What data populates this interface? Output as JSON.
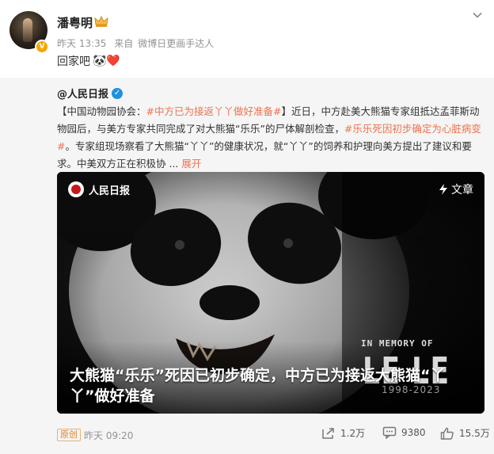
{
  "post": {
    "username": "潘粤明",
    "time": "昨天 13:35",
    "source_prefix": "来自",
    "source": "微博日更画手达人",
    "content": "回家吧",
    "content_emoji": "🐼❤️"
  },
  "repost": {
    "user": "@人民日报",
    "text_prefix": "【中国动物园协会：",
    "hashtag1": "#中方已为接返丫丫做好准备#",
    "text_mid1": "】近日，中方赴美大熊猫专家组抵达孟菲斯动物园后，与美方专家共同完成了对大熊猫“乐乐”的尸体解剖检查，",
    "hashtag2": "#乐乐死因初步确定为心脏病变#",
    "text_mid2": "。专家组现场察看了大熊猫“丫丫”的健康状况，就“丫丫”的饲养和护理向美方提出了建议和要求。中美双方正在积极协",
    "ellipsis": " ... ",
    "expand": "展开",
    "video": {
      "channel": "人民日报",
      "article_label": "文章",
      "memory_line1": "IN MEMORY OF",
      "memory_line2": "LE LE",
      "memory_line3": "1998-2023",
      "caption": "大熊猫“乐乐”死因已初步确定，中方已为接返大熊猫“丫丫”做好准备"
    },
    "footer": {
      "original_badge": "原创",
      "time": "昨天 09:20",
      "shares": "1.2万",
      "comments": "9380",
      "likes": "15.5万"
    }
  },
  "colors": {
    "accent": "#eb7350",
    "verified_orange": "#f7a600",
    "verified_blue": "#1e90e0"
  }
}
